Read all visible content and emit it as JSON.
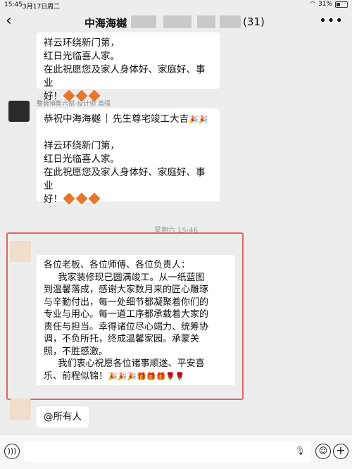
{
  "status_bar": {
    "time": "15:45",
    "date": "3月17日周二",
    "battery": "31%"
  },
  "header": {
    "title": "中海海樾",
    "count": "(31)"
  },
  "messages": [
    {
      "lines": [
        "祥云环绕新门第，",
        "红日光临喜人家。",
        "在此祝愿您及家人身体好、家庭好、事业",
        "好！"
      ]
    },
    {
      "sender": "整装销售六部-设计师 高强",
      "line1_a": "恭祝中海海樾",
      "line1_b": "先生尊宅竣工大吉",
      "lines": [
        "祥云环绕新门第，",
        "红日光临喜人家。",
        "在此祝愿您及家人身体好、家庭好、事业",
        "好！"
      ]
    }
  ],
  "timestamp": "星期六 15:46",
  "main_message": {
    "lines": [
      "各位老板、各位师傅、各位负责人：",
      "     我家装修现已圆满竣工。从一纸蓝图",
      "到温馨落成，感谢大家数月来的匠心雕琢",
      "与辛勤付出，每一处细节都凝聚着你们的",
      "专业与用心。每一道工序都承载着大家的",
      "责任与担当。幸得诸位尽心竭力、统筹协",
      "调，不负所托，终成温馨家园。承蒙关",
      "照，不胜感激。",
      "     我们衷心祝愿各位诸事顺遂、平安喜",
      "乐、前程似锦！"
    ]
  },
  "last_message": "@所有人",
  "icons": {
    "back": "back-chevron-icon",
    "more": "more-options-icon",
    "voice": "voice-input-icon",
    "emoji": "emoji-icon",
    "plus": "plus-icon"
  }
}
